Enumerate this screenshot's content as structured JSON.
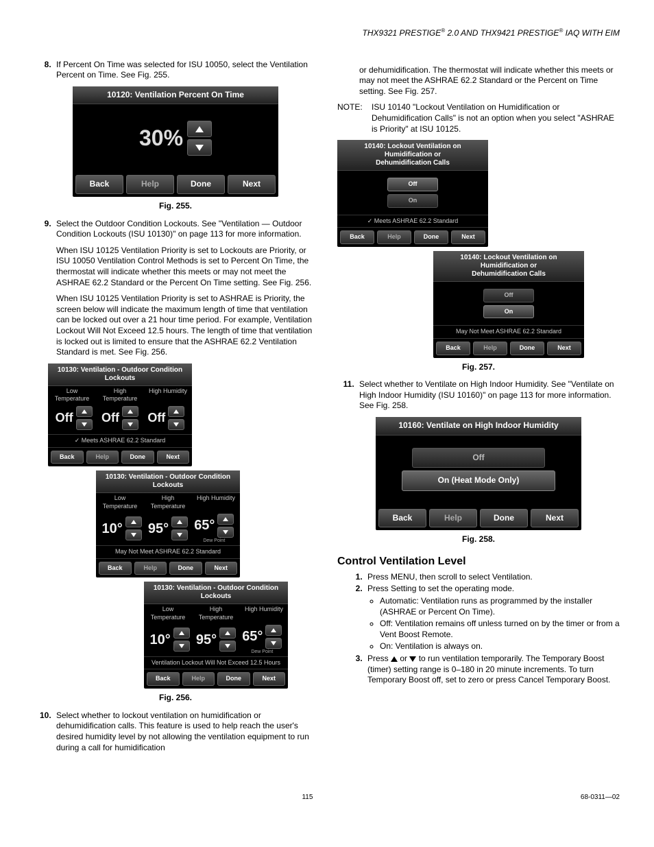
{
  "header": {
    "part1": "THX9321 PRESTIGE",
    "reg": "®",
    "part2": " 2.0 AND THX9421 PRESTIGE",
    "part3": " IAQ WITH EIM"
  },
  "left": {
    "item8": "If Percent On Time was selected for ISU 10050, select the Ventilation Percent on Time. See Fig. 255.",
    "fig255": {
      "title": "10120: Ventilation Percent On Time",
      "value": "30%",
      "back": "Back",
      "help": "Help",
      "done": "Done",
      "next": "Next",
      "caption": "Fig. 255."
    },
    "item9": "Select the Outdoor Condition Lockouts. See \"Ventilation — Outdoor Condition Lockouts (ISU 10130)\" on page 113 for more information.",
    "para9a": "When ISU 10125 Ventilation Priority is set to Lockouts are Priority, or ISU 10050 Ventilation Control Methods is set to Percent On Time, the thermostat will indicate whether this meets or may not meet the ASHRAE 62.2 Standard or the Percent On Time setting. See Fig. 256.",
    "para9b": "When ISU 10125 Ventilation Priority is set to ASHRAE is Priority, the screen below will indicate the maximum length of time that ventilation can be locked out over a 21 hour time period. For example, Ventilation Lockout Will Not Exceed 12.5 hours. The length of time that ventilation is locked out is limited to ensure that the ASHRAE 62.2 Ventilation Standard is met. See Fig. 256.",
    "fig256": {
      "title": "10130: Ventilation - Outdoor Condition Lockouts",
      "hdr_low": "Low Temperature",
      "hdr_high": "High\nTemperature",
      "hdr_hum": "High Humidity",
      "off": "Off",
      "v10": "10°",
      "v95": "95°",
      "v65": "65°",
      "dew": "Dew Point",
      "meets": "Meets ASHRAE 62.2 Standard",
      "maynot": "May Not Meet ASHRAE 62.2 Standard",
      "lockout_msg": "Ventilation Lockout Will Not Exceed 12.5 Hours",
      "back": "Back",
      "help": "Help",
      "done": "Done",
      "next": "Next",
      "caption": "Fig. 256."
    },
    "item10": "Select whether to lockout ventilation on humidification or dehumidification calls. This feature is used to help reach the user's desired humidity level by not allowing the ventilation equipment to run during a call for humidification"
  },
  "right": {
    "cont10": "or dehumidification. The thermostat will indicate whether this meets or may not meet the ASHRAE 62.2 Standard or the Percent on Time setting. See Fig. 257.",
    "note_label": "NOTE:",
    "note": "ISU 10140 \"Lockout Ventilation on Humidification or Dehumidification Calls\" is not an option when you select \"ASHRAE is Priority\" at ISU 10125.",
    "fig257": {
      "title": "10140: Lockout Ventilation on Humidification or\nDehumidification Calls",
      "off": "Off",
      "on": "On",
      "meets": "Meets ASHRAE 62.2 Standard",
      "maynot": "May Not Meet ASHRAE 62.2 Standard",
      "back": "Back",
      "help": "Help",
      "done": "Done",
      "next": "Next",
      "caption": "Fig. 257."
    },
    "item11": "Select whether to Ventilate on High Indoor Humidity. See \"Ventilate on High Indoor Humidity (ISU 10160)\" on page 113 for more information. See Fig. 258.",
    "fig258": {
      "title": "10160: Ventilate on High Indoor Humidity",
      "off": "Off",
      "on": "On (Heat Mode Only)",
      "back": "Back",
      "help": "Help",
      "done": "Done",
      "next": "Next",
      "caption": "Fig. 258."
    },
    "section": "Control Ventilation Level",
    "s1": "Press MENU, then scroll to select Ventilation.",
    "s2": "Press Setting to set the operating mode.",
    "b1": "Automatic: Ventilation runs as programmed by the installer (ASHRAE or Percent On Time).",
    "b2": "Off: Ventilation remains off unless turned on by the timer or from a Vent Boost Remote.",
    "b3": "On: Ventilation is always on.",
    "s3a": "Press ",
    "s3b": " or ",
    "s3c": " to run ventilation temporarily. The Temporary Boost (timer) setting range is 0–180 in 20 minute increments. To turn Temporary Boost off, set to zero or press Cancel Temporary Boost."
  },
  "footer": {
    "page": "115",
    "doc": "68-0311—02"
  }
}
